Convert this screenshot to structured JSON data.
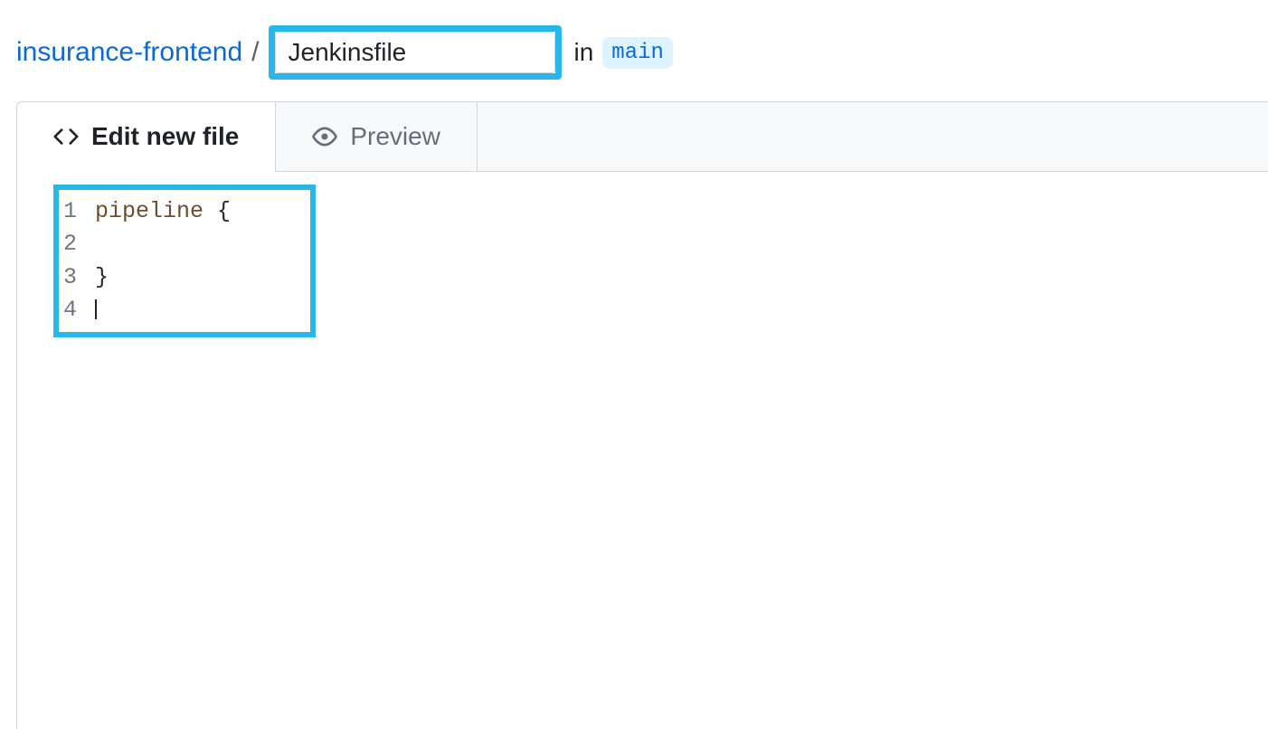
{
  "breadcrumb": {
    "repo_name": "insurance-frontend",
    "separator": "/",
    "filename_value": "Jenkinsfile",
    "in_text": "in",
    "branch": "main"
  },
  "tabs": {
    "edit": {
      "label": "Edit new file"
    },
    "preview": {
      "label": "Preview"
    }
  },
  "editor": {
    "lines": [
      {
        "num": "1",
        "keyword": "pipeline",
        "rest": " {"
      },
      {
        "num": "2",
        "keyword": "",
        "rest": ""
      },
      {
        "num": "3",
        "keyword": "",
        "rest": "}"
      },
      {
        "num": "4",
        "keyword": "",
        "rest": ""
      }
    ]
  },
  "highlights": {
    "color": "#29b6e8"
  }
}
